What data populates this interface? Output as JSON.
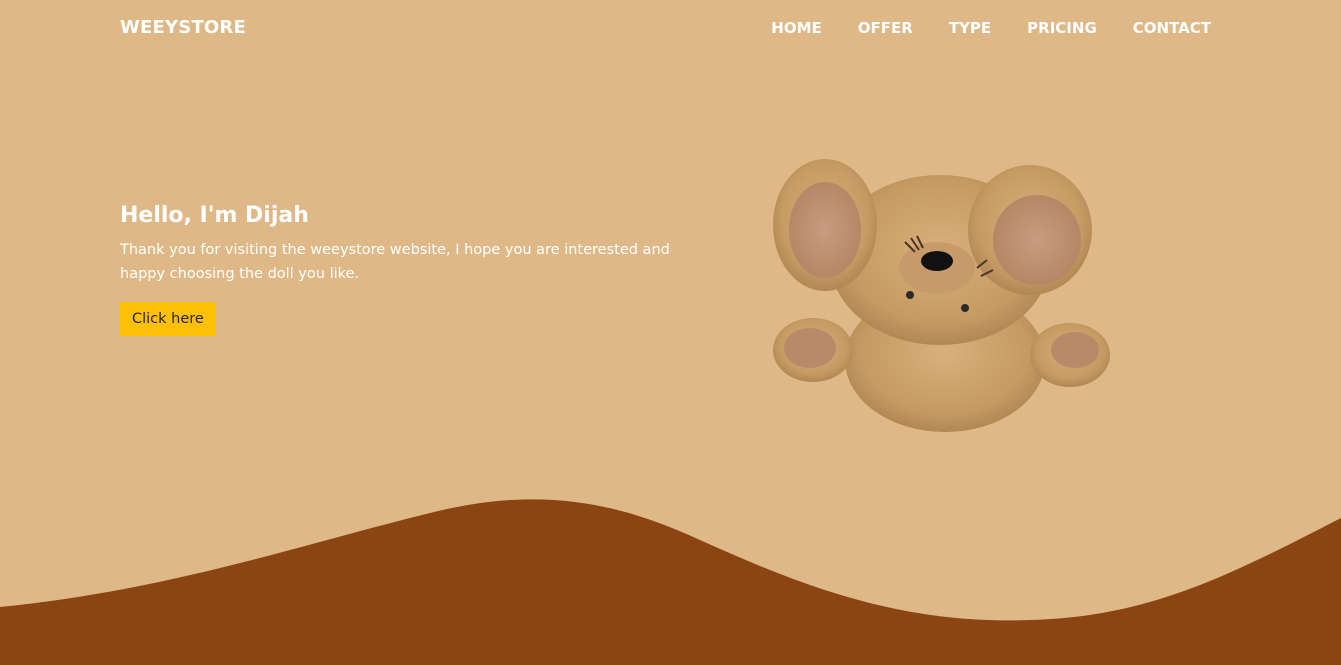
{
  "nav": {
    "brand": "WEEYSTORE",
    "items": [
      "HOME",
      "OFFER",
      "TYPE",
      "PRICING",
      "CONTACT"
    ]
  },
  "hero": {
    "title": "Hello, I'm Dijah",
    "text": "Thank you for visiting the weeystore website, I hope you are interested and happy choosing the doll you like.",
    "button_label": "Click here"
  },
  "colors": {
    "background": "#dfb887",
    "wave": "#8b4513",
    "button": "#ffc107",
    "text": "#ffffff"
  },
  "image": {
    "name": "teddy-bear-image"
  }
}
